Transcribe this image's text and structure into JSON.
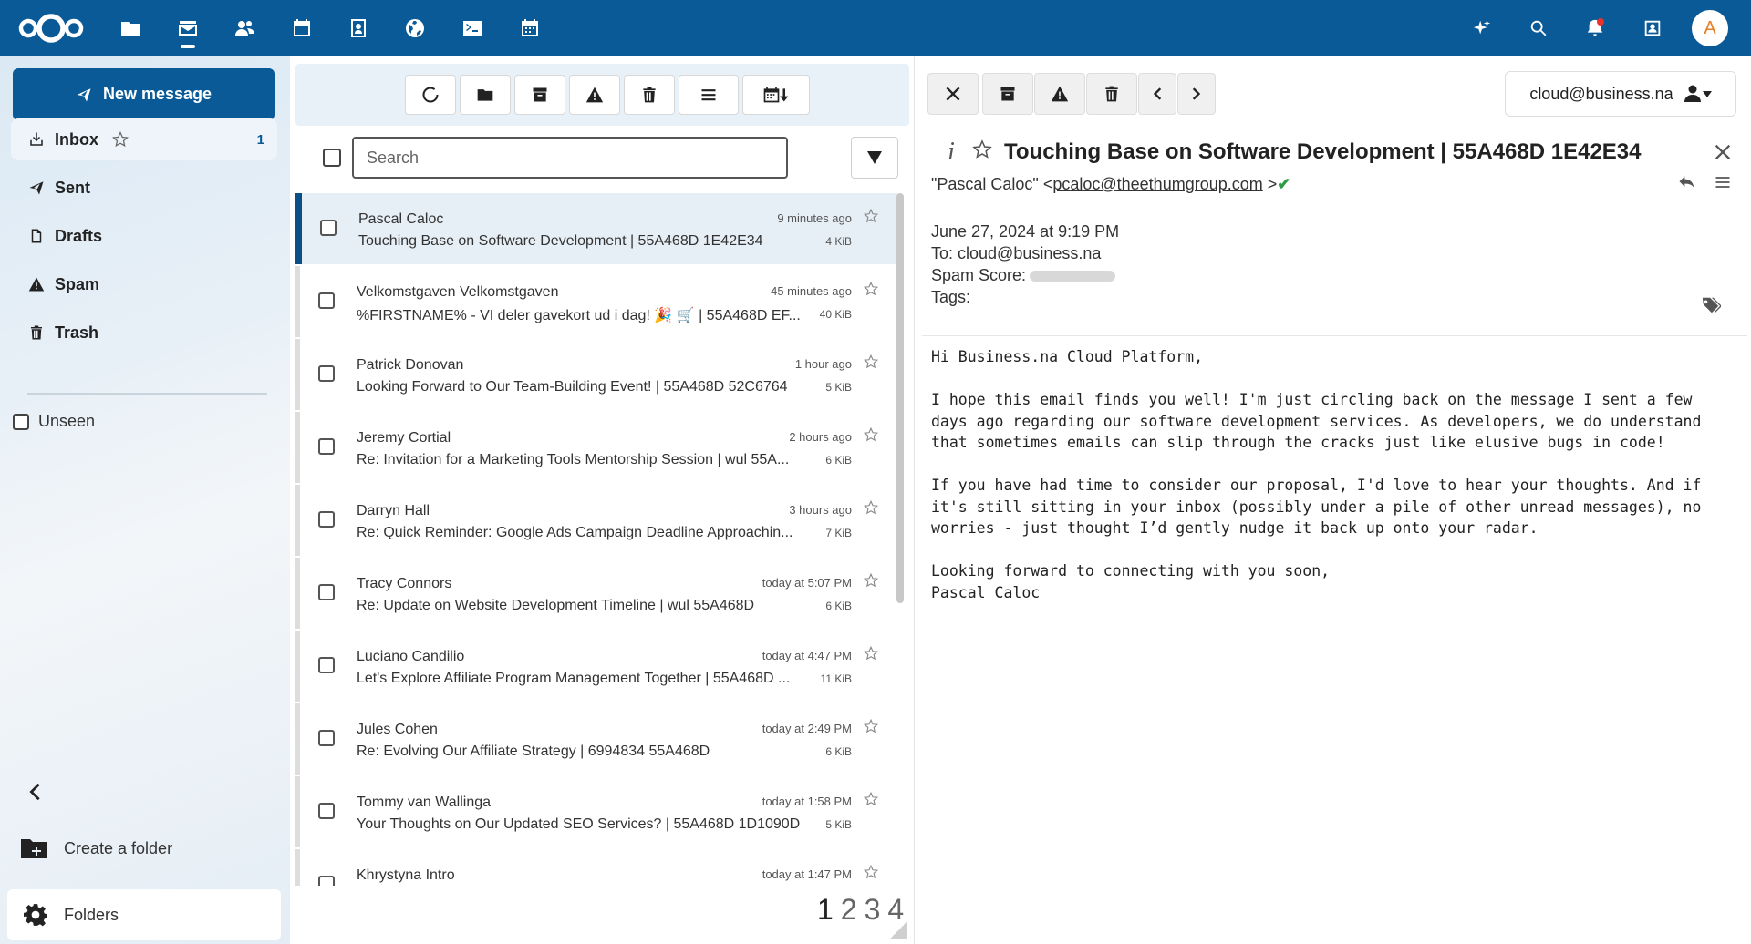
{
  "sidebar": {
    "new_message": "New message",
    "folders": [
      {
        "label": "Inbox",
        "count": "1"
      },
      {
        "label": "Sent"
      },
      {
        "label": "Drafts"
      },
      {
        "label": "Spam"
      },
      {
        "label": "Trash"
      }
    ],
    "unseen_label": "Unseen",
    "create_folder": "Create a folder",
    "folders_settings": "Folders"
  },
  "list": {
    "search_placeholder": "Search",
    "messages": [
      {
        "sender": "Pascal Caloc",
        "subject": "Touching Base on Software Development | 55A468D 1E42E34",
        "time": "9 minutes ago",
        "size": "4 KiB"
      },
      {
        "sender": "Velkomstgaven Velkomstgaven",
        "subject": "%FIRSTNAME% - VI deler gavekort ud i dag! 🎉 🛒 | 55A468D EF...",
        "time": "45 minutes ago",
        "size": "40 KiB"
      },
      {
        "sender": "Patrick Donovan",
        "subject": "Looking Forward to Our Team-Building Event! | 55A468D 52C6764",
        "time": "1 hour ago",
        "size": "5 KiB"
      },
      {
        "sender": "Jeremy Cortial",
        "subject": "Re: Invitation for a Marketing Tools Mentorship Session | wul 55A...",
        "time": "2 hours ago",
        "size": "6 KiB"
      },
      {
        "sender": "Darryn Hall",
        "subject": "Re: Quick Reminder: Google Ads Campaign Deadline Approachin...",
        "time": "3 hours ago",
        "size": "7 KiB"
      },
      {
        "sender": "Tracy Connors",
        "subject": "Re: Update on Website Development Timeline | wul 55A468D",
        "time": "today at 5:07 PM",
        "size": "6 KiB"
      },
      {
        "sender": "Luciano Candilio",
        "subject": "Let's Explore Affiliate Program Management Together | 55A468D ...",
        "time": "today at 4:47 PM",
        "size": "11 KiB"
      },
      {
        "sender": "Jules Cohen",
        "subject": "Re: Evolving Our Affiliate Strategy | 6994834 55A468D",
        "time": "today at 2:49 PM",
        "size": "6 KiB"
      },
      {
        "sender": "Tommy van Wallinga",
        "subject": "Your Thoughts on Our Updated SEO Services? | 55A468D 1D1090D",
        "time": "today at 1:58 PM",
        "size": "5 KiB"
      },
      {
        "sender": "Khrystyna Intro",
        "subject": "",
        "time": "today at 1:47 PM",
        "size": ""
      }
    ],
    "pages": [
      "1",
      "2",
      "3",
      "4"
    ]
  },
  "reader": {
    "account": "cloud@business.na",
    "subject": "Touching Base on Software Development | 55A468D 1E42E34",
    "from_name": "\"Pascal Caloc\" <",
    "from_email": "pcaloc@theethumgroup.com",
    "from_close": ">",
    "date": "June 27, 2024 at 9:19 PM",
    "to": "To: cloud@business.na",
    "spam_label": "Spam Score:",
    "tags_label": "Tags:",
    "body": "Hi Business.na Cloud Platform,\n\nI hope this email finds you well! I'm just circling back on the message I sent a few\ndays ago regarding our software development services. As developers, we do understand\nthat sometimes emails can slip through the cracks just like elusive bugs in code!\n\nIf you have had time to consider our proposal, I'd love to hear your thoughts. And if\nit's still sitting in your inbox (possibly under a pile of other unread messages), no\nworries - just thought I’d gently nudge it back up onto your radar.\n\nLooking forward to connecting with you soon,\nPascal Caloc"
  },
  "user": {
    "avatar_letter": "A"
  },
  "colors": {
    "brand": "#0a5a97",
    "active_row_border": "#0a4f85"
  }
}
